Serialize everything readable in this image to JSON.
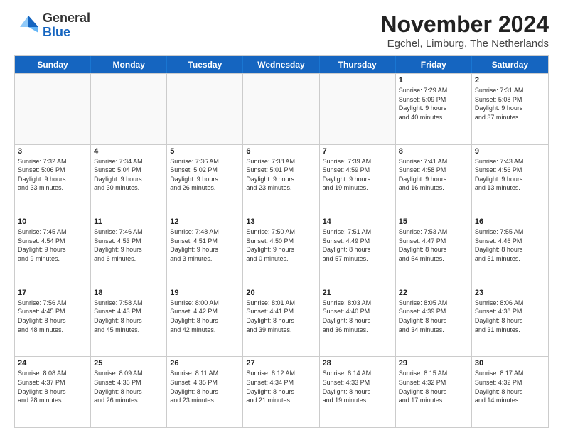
{
  "logo": {
    "general": "General",
    "blue": "Blue"
  },
  "title": "November 2024",
  "subtitle": "Egchel, Limburg, The Netherlands",
  "days_of_week": [
    "Sunday",
    "Monday",
    "Tuesday",
    "Wednesday",
    "Thursday",
    "Friday",
    "Saturday"
  ],
  "rows": [
    [
      {
        "day": "",
        "info": "",
        "empty": true
      },
      {
        "day": "",
        "info": "",
        "empty": true
      },
      {
        "day": "",
        "info": "",
        "empty": true
      },
      {
        "day": "",
        "info": "",
        "empty": true
      },
      {
        "day": "",
        "info": "",
        "empty": true
      },
      {
        "day": "1",
        "info": "Sunrise: 7:29 AM\nSunset: 5:09 PM\nDaylight: 9 hours\nand 40 minutes.",
        "empty": false
      },
      {
        "day": "2",
        "info": "Sunrise: 7:31 AM\nSunset: 5:08 PM\nDaylight: 9 hours\nand 37 minutes.",
        "empty": false
      }
    ],
    [
      {
        "day": "3",
        "info": "Sunrise: 7:32 AM\nSunset: 5:06 PM\nDaylight: 9 hours\nand 33 minutes.",
        "empty": false
      },
      {
        "day": "4",
        "info": "Sunrise: 7:34 AM\nSunset: 5:04 PM\nDaylight: 9 hours\nand 30 minutes.",
        "empty": false
      },
      {
        "day": "5",
        "info": "Sunrise: 7:36 AM\nSunset: 5:02 PM\nDaylight: 9 hours\nand 26 minutes.",
        "empty": false
      },
      {
        "day": "6",
        "info": "Sunrise: 7:38 AM\nSunset: 5:01 PM\nDaylight: 9 hours\nand 23 minutes.",
        "empty": false
      },
      {
        "day": "7",
        "info": "Sunrise: 7:39 AM\nSunset: 4:59 PM\nDaylight: 9 hours\nand 19 minutes.",
        "empty": false
      },
      {
        "day": "8",
        "info": "Sunrise: 7:41 AM\nSunset: 4:58 PM\nDaylight: 9 hours\nand 16 minutes.",
        "empty": false
      },
      {
        "day": "9",
        "info": "Sunrise: 7:43 AM\nSunset: 4:56 PM\nDaylight: 9 hours\nand 13 minutes.",
        "empty": false
      }
    ],
    [
      {
        "day": "10",
        "info": "Sunrise: 7:45 AM\nSunset: 4:54 PM\nDaylight: 9 hours\nand 9 minutes.",
        "empty": false
      },
      {
        "day": "11",
        "info": "Sunrise: 7:46 AM\nSunset: 4:53 PM\nDaylight: 9 hours\nand 6 minutes.",
        "empty": false
      },
      {
        "day": "12",
        "info": "Sunrise: 7:48 AM\nSunset: 4:51 PM\nDaylight: 9 hours\nand 3 minutes.",
        "empty": false
      },
      {
        "day": "13",
        "info": "Sunrise: 7:50 AM\nSunset: 4:50 PM\nDaylight: 9 hours\nand 0 minutes.",
        "empty": false
      },
      {
        "day": "14",
        "info": "Sunrise: 7:51 AM\nSunset: 4:49 PM\nDaylight: 8 hours\nand 57 minutes.",
        "empty": false
      },
      {
        "day": "15",
        "info": "Sunrise: 7:53 AM\nSunset: 4:47 PM\nDaylight: 8 hours\nand 54 minutes.",
        "empty": false
      },
      {
        "day": "16",
        "info": "Sunrise: 7:55 AM\nSunset: 4:46 PM\nDaylight: 8 hours\nand 51 minutes.",
        "empty": false
      }
    ],
    [
      {
        "day": "17",
        "info": "Sunrise: 7:56 AM\nSunset: 4:45 PM\nDaylight: 8 hours\nand 48 minutes.",
        "empty": false
      },
      {
        "day": "18",
        "info": "Sunrise: 7:58 AM\nSunset: 4:43 PM\nDaylight: 8 hours\nand 45 minutes.",
        "empty": false
      },
      {
        "day": "19",
        "info": "Sunrise: 8:00 AM\nSunset: 4:42 PM\nDaylight: 8 hours\nand 42 minutes.",
        "empty": false
      },
      {
        "day": "20",
        "info": "Sunrise: 8:01 AM\nSunset: 4:41 PM\nDaylight: 8 hours\nand 39 minutes.",
        "empty": false
      },
      {
        "day": "21",
        "info": "Sunrise: 8:03 AM\nSunset: 4:40 PM\nDaylight: 8 hours\nand 36 minutes.",
        "empty": false
      },
      {
        "day": "22",
        "info": "Sunrise: 8:05 AM\nSunset: 4:39 PM\nDaylight: 8 hours\nand 34 minutes.",
        "empty": false
      },
      {
        "day": "23",
        "info": "Sunrise: 8:06 AM\nSunset: 4:38 PM\nDaylight: 8 hours\nand 31 minutes.",
        "empty": false
      }
    ],
    [
      {
        "day": "24",
        "info": "Sunrise: 8:08 AM\nSunset: 4:37 PM\nDaylight: 8 hours\nand 28 minutes.",
        "empty": false
      },
      {
        "day": "25",
        "info": "Sunrise: 8:09 AM\nSunset: 4:36 PM\nDaylight: 8 hours\nand 26 minutes.",
        "empty": false
      },
      {
        "day": "26",
        "info": "Sunrise: 8:11 AM\nSunset: 4:35 PM\nDaylight: 8 hours\nand 23 minutes.",
        "empty": false
      },
      {
        "day": "27",
        "info": "Sunrise: 8:12 AM\nSunset: 4:34 PM\nDaylight: 8 hours\nand 21 minutes.",
        "empty": false
      },
      {
        "day": "28",
        "info": "Sunrise: 8:14 AM\nSunset: 4:33 PM\nDaylight: 8 hours\nand 19 minutes.",
        "empty": false
      },
      {
        "day": "29",
        "info": "Sunrise: 8:15 AM\nSunset: 4:32 PM\nDaylight: 8 hours\nand 17 minutes.",
        "empty": false
      },
      {
        "day": "30",
        "info": "Sunrise: 8:17 AM\nSunset: 4:32 PM\nDaylight: 8 hours\nand 14 minutes.",
        "empty": false
      }
    ]
  ]
}
